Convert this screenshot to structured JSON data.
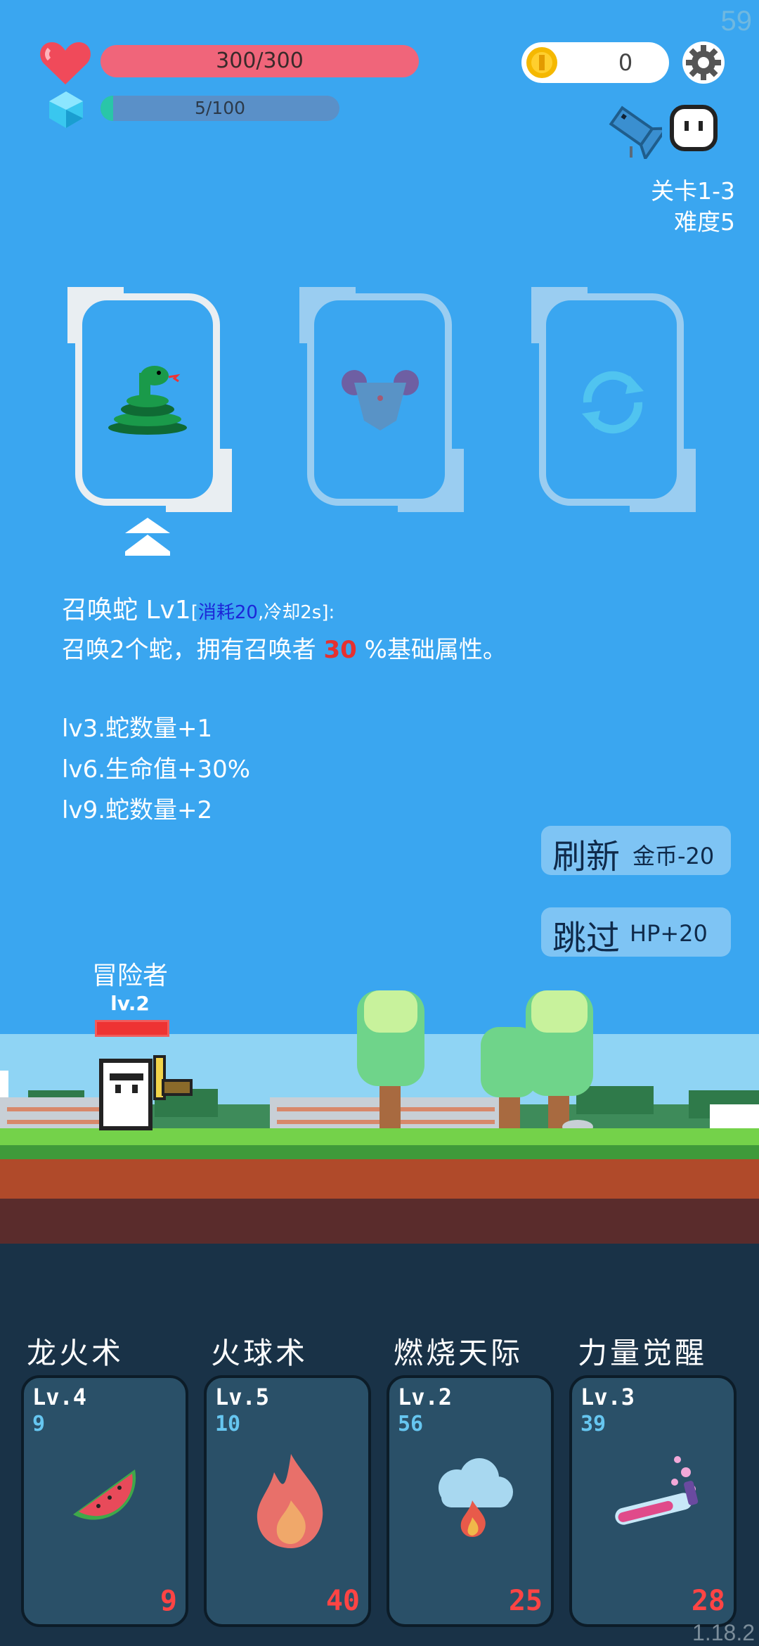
{
  "fps": "59",
  "player": {
    "hp_text": "300/300",
    "mp_text": "5/100",
    "mp_level": 0.05
  },
  "coins": "0",
  "level": {
    "stage": "关卡1-3",
    "difficulty": "难度5"
  },
  "skill_offer": {
    "name": "召唤蛇 Lv1",
    "bracket_open": "[",
    "cost": "消耗20",
    "cooldown": ",冷却2s",
    "bracket_close": "]:",
    "desc_prefix": "召唤2个蛇，拥有召唤者",
    "desc_value": "30",
    "desc_suffix": "%基础属性。",
    "upgrades": [
      "lv3.蛇数量+1",
      "lv6.生命值+30%",
      "lv9.蛇数量+2"
    ]
  },
  "buttons": {
    "refresh_label": "刷新",
    "refresh_cost": "金币-20",
    "skip_label": "跳过",
    "skip_bonus": "HP+20"
  },
  "hero": {
    "name": "冒险者",
    "level": "lv.2"
  },
  "skills": [
    {
      "name": "龙火术",
      "lv": "Lv.4",
      "cost": "9",
      "count": "9",
      "icon": "watermelon-icon"
    },
    {
      "name": "火球术",
      "lv": "Lv.5",
      "cost": "10",
      "count": "40",
      "icon": "fire-icon"
    },
    {
      "name": "燃烧天际",
      "lv": "Lv.2",
      "cost": "56",
      "count": "25",
      "icon": "fire-cloud-icon"
    },
    {
      "name": "力量觉醒",
      "lv": "Lv.3",
      "cost": "39",
      "count": "28",
      "icon": "potion-tube-icon"
    }
  ],
  "version": "1.18.2",
  "colors": {
    "sky": "#3aa6f0",
    "hp": "#f0657a",
    "mp": "#29c6a8",
    "accent_cost": "#1c27d8",
    "highlight": "#e63030"
  }
}
